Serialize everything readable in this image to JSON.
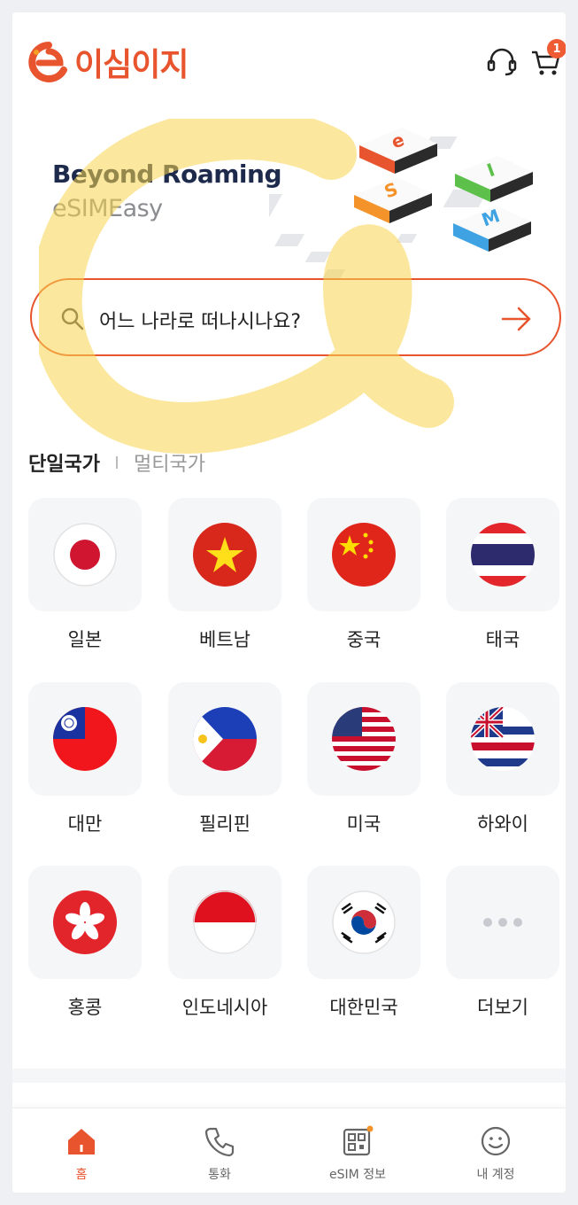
{
  "app": {
    "logo_text": "이심이지"
  },
  "header": {
    "cart_badge": "1"
  },
  "banner": {
    "title": "Beyond Roaming",
    "subtitle": "eSIMEasy"
  },
  "search": {
    "placeholder": "어느 나라로 떠나시나요?"
  },
  "tabs": {
    "active": "단일국가",
    "inactive": "멀티국가"
  },
  "countries": [
    {
      "label": "일본",
      "icon": "japan-flag-icon"
    },
    {
      "label": "베트남",
      "icon": "vietnam-flag-icon"
    },
    {
      "label": "중국",
      "icon": "china-flag-icon"
    },
    {
      "label": "태국",
      "icon": "thailand-flag-icon"
    },
    {
      "label": "대만",
      "icon": "taiwan-flag-icon"
    },
    {
      "label": "필리핀",
      "icon": "philippines-flag-icon"
    },
    {
      "label": "미국",
      "icon": "usa-flag-icon"
    },
    {
      "label": "하와이",
      "icon": "hawaii-flag-icon"
    },
    {
      "label": "홍콩",
      "icon": "hongkong-flag-icon"
    },
    {
      "label": "인도네시아",
      "icon": "indonesia-flag-icon"
    },
    {
      "label": "대한민국",
      "icon": "korea-flag-icon"
    },
    {
      "label": "더보기",
      "icon": "more-dots-icon"
    }
  ],
  "nav": [
    {
      "label": "홈",
      "icon": "home-icon"
    },
    {
      "label": "통화",
      "icon": "phone-icon"
    },
    {
      "label": "eSIM 정보",
      "icon": "esim-info-icon"
    },
    {
      "label": "내 계정",
      "icon": "account-icon"
    }
  ],
  "colors": {
    "accent": "#e8542d",
    "navy": "#1d2a4b",
    "tile_bg": "#f5f6f8"
  }
}
